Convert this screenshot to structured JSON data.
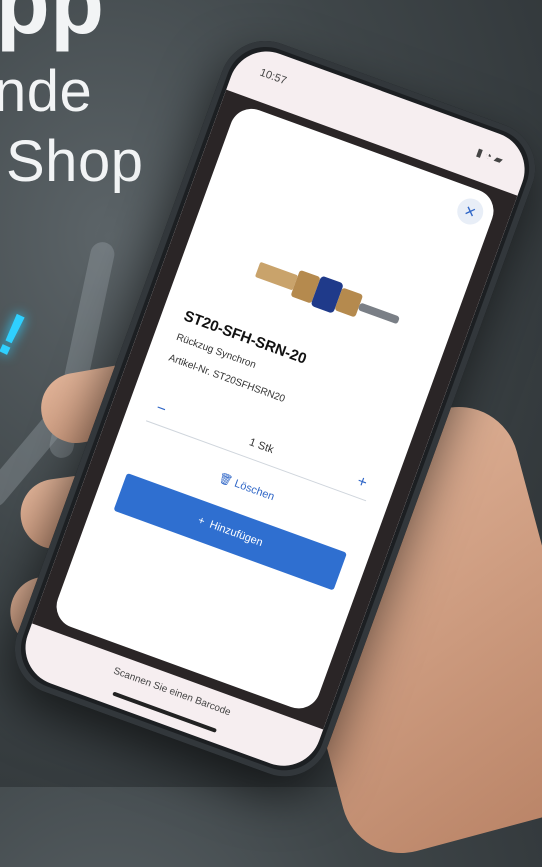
{
  "headline": {
    "line1": "pp",
    "line2": "nde",
    "line3": "Shop"
  },
  "phone": {
    "status_time": "10:57",
    "status_icons": "signal-wifi-battery"
  },
  "product": {
    "title": "ST20-SFH-SRN-20",
    "subtitle": "Rückzug Synchron",
    "part_number": "Artikel-Nr. ST20SFHSRN20"
  },
  "quantity": {
    "minus": "−",
    "value": "1 Stk",
    "plus": "+"
  },
  "actions": {
    "delete_label": "Löschen",
    "add_label": "Hinzufügen"
  },
  "footer": {
    "scan_hint": "Scannen Sie einen Barcode"
  },
  "colors": {
    "accent": "#2f6fd0",
    "highlight": "#2fd0ff"
  }
}
